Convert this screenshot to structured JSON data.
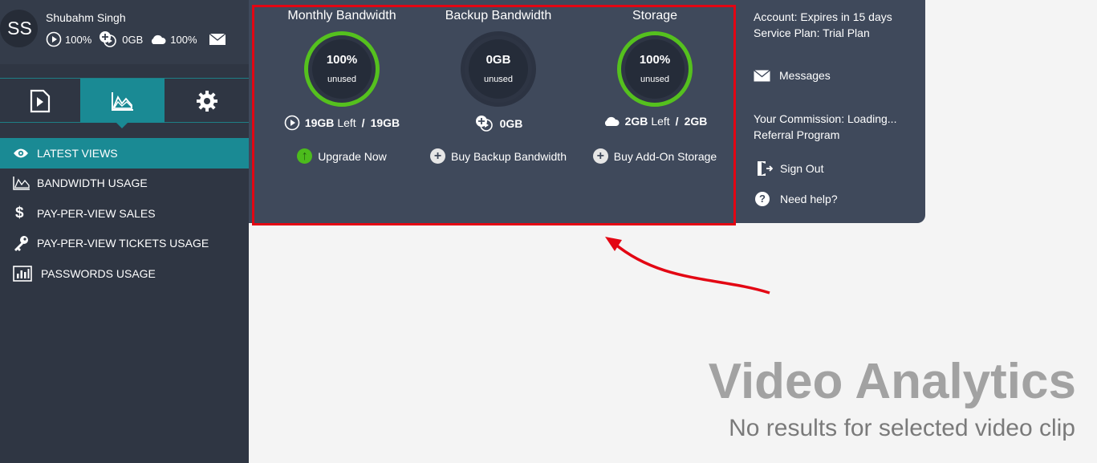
{
  "user": {
    "initials": "SS",
    "name": "Shubahm Singh",
    "stats": {
      "bandwidth": "100%",
      "backup": "0GB",
      "storage": "100%"
    }
  },
  "tabs": [
    {
      "name": "videos",
      "icon": "play-file-icon"
    },
    {
      "name": "analytics",
      "icon": "chart-icon",
      "active": true
    },
    {
      "name": "settings",
      "icon": "gear-icon"
    }
  ],
  "menu": [
    {
      "label": "LATEST VIEWS",
      "icon": "eye-icon",
      "active": true
    },
    {
      "label": "BANDWIDTH USAGE",
      "icon": "chart-icon"
    },
    {
      "label": "PAY-PER-VIEW SALES",
      "icon": "dollar-icon"
    },
    {
      "label": "PAY-PER-VIEW TICKETS USAGE",
      "icon": "key-icon"
    },
    {
      "label": "PASSWORDS USAGE",
      "icon": "bar-chart-icon"
    }
  ],
  "panel": {
    "monthly": {
      "title": "Monthly Bandwidth",
      "value": "100%",
      "sub": "unused",
      "left": "19GB",
      "left_label": "Left",
      "total": "19GB",
      "action": "Upgrade Now"
    },
    "backup": {
      "title": "Backup Bandwidth",
      "value": "0GB",
      "sub": "unused",
      "amount": "0GB",
      "action": "Buy Backup Bandwidth"
    },
    "storage": {
      "title": "Storage",
      "value": "100%",
      "sub": "unused",
      "left": "2GB",
      "left_label": "Left",
      "total": "2GB",
      "action": "Buy Add-On Storage"
    }
  },
  "account": {
    "expires": "Account: Expires in 15 days",
    "plan": "Service Plan: Trial Plan",
    "messages": "Messages",
    "commission": "Your Commission: Loading...",
    "referral": "Referral Program",
    "sign_out": "Sign Out",
    "help": "Need help?"
  },
  "main": {
    "title": "Video Analytics",
    "subtitle": "No results for selected video clip"
  },
  "colors": {
    "accent": "#1a8a94",
    "ring_green": "#55c11e",
    "highlight_red": "#e30613"
  }
}
